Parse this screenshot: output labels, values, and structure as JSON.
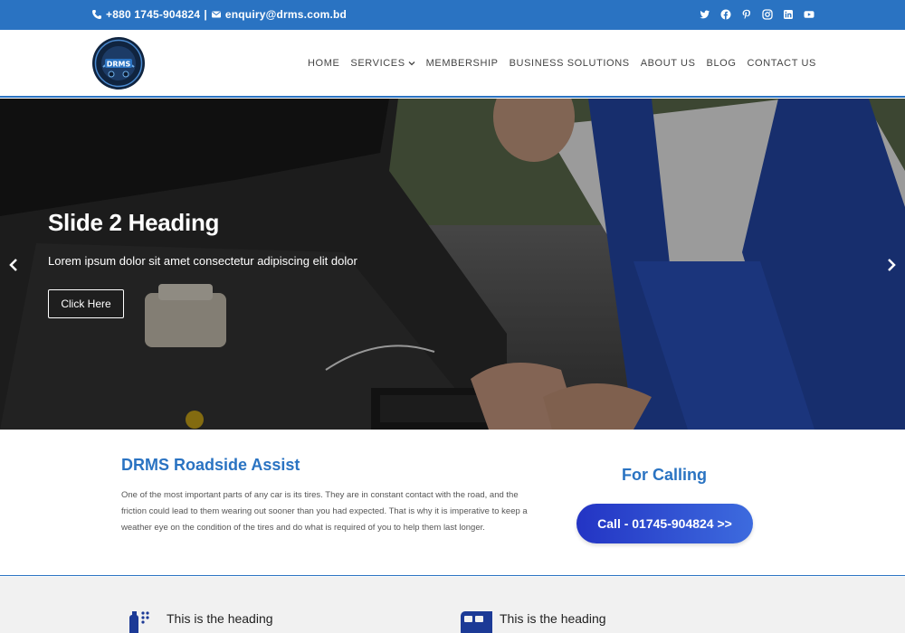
{
  "topbar": {
    "phone": "+880 1745-904824",
    "separator": "|",
    "email": "enquiry@drms.com.bd",
    "social": [
      "twitter-icon",
      "facebook-icon",
      "pinterest-icon",
      "instagram-icon",
      "linkedin-icon",
      "youtube-icon"
    ]
  },
  "header": {
    "logo_text": "DRMS",
    "nav": [
      {
        "label": "HOME"
      },
      {
        "label": "SERVICES"
      },
      {
        "label": "MEMBERSHIP"
      },
      {
        "label": "BUSINESS SOLUTIONS"
      },
      {
        "label": "ABOUT US"
      },
      {
        "label": "BLOG"
      },
      {
        "label": "CONTACT US"
      }
    ]
  },
  "hero": {
    "heading": "Slide 2 Heading",
    "subtext": "Lorem ipsum dolor sit amet consectetur adipiscing elit dolor",
    "button": "Click Here"
  },
  "info": {
    "title": "DRMS Roadside Assist",
    "paragraph": "One of the most important parts of any car is its tires. They are in constant contact with the road, and the friction could lead to them wearing out sooner than you had expected. That is why it is imperative to keep a weather eye on the condition of the tires and do what is required of you to help them last longer.",
    "call_title": "For Calling",
    "call_button": "Call - 01745-904824 >>"
  },
  "features": [
    {
      "heading": "This is the heading"
    },
    {
      "heading": "This is the heading"
    }
  ],
  "colors": {
    "brand_blue": "#2a73c2",
    "button_gradient_start": "#2334c4",
    "button_gradient_end": "#3d6bde"
  }
}
